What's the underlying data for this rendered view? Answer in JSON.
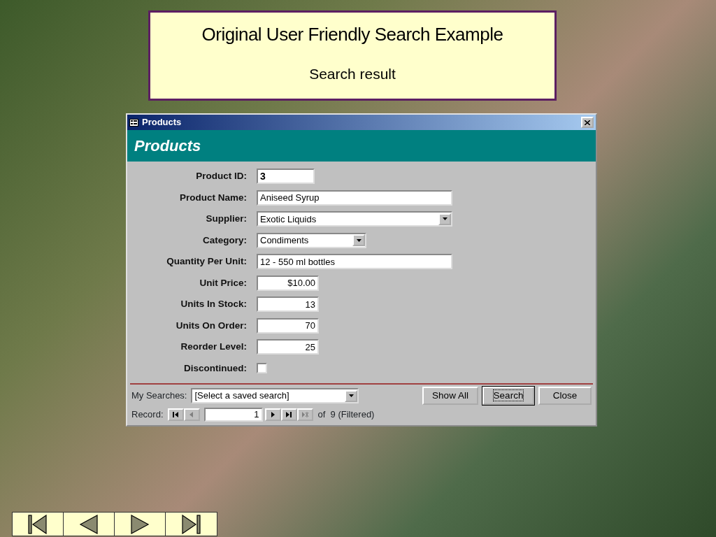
{
  "slide": {
    "title": "Original User Friendly Search Example",
    "subtitle": "Search result"
  },
  "window": {
    "title": "Products",
    "header": "Products"
  },
  "fields": [
    {
      "label": "Product ID:",
      "kind": "id",
      "value": "3"
    },
    {
      "label": "Product Name:",
      "kind": "text",
      "value": "Aniseed Syrup"
    },
    {
      "label": "Supplier:",
      "kind": "combo",
      "value": "Exotic Liquids"
    },
    {
      "label": "Category:",
      "kind": "combo",
      "value": "Condiments"
    },
    {
      "label": "Quantity Per Unit:",
      "kind": "text",
      "value": "12 - 550 ml bottles"
    },
    {
      "label": "Unit Price:",
      "kind": "number",
      "value": "$10.00"
    },
    {
      "label": "Units In Stock:",
      "kind": "number",
      "value": "13"
    },
    {
      "label": "Units On Order:",
      "kind": "number",
      "value": "70"
    },
    {
      "label": "Reorder Level:",
      "kind": "number",
      "value": "25"
    },
    {
      "label": "Discontinued:",
      "kind": "checkbox",
      "checked": false
    }
  ],
  "searches": {
    "label": "My Searches:",
    "value": "[Select a saved search]"
  },
  "buttons": [
    {
      "label": "Show All",
      "focused": false
    },
    {
      "label": "Search",
      "focused": true
    },
    {
      "label": "Close",
      "focused": false
    }
  ],
  "record": {
    "label": "Record:",
    "current": "1",
    "total": "of  9 (Filtered)",
    "nav": [
      {
        "kind": "first",
        "disabled": false
      },
      {
        "kind": "prev",
        "disabled": true
      },
      {
        "kind": "next",
        "disabled": false
      },
      {
        "kind": "last",
        "disabled": false
      },
      {
        "kind": "new",
        "disabled": true
      }
    ]
  }
}
